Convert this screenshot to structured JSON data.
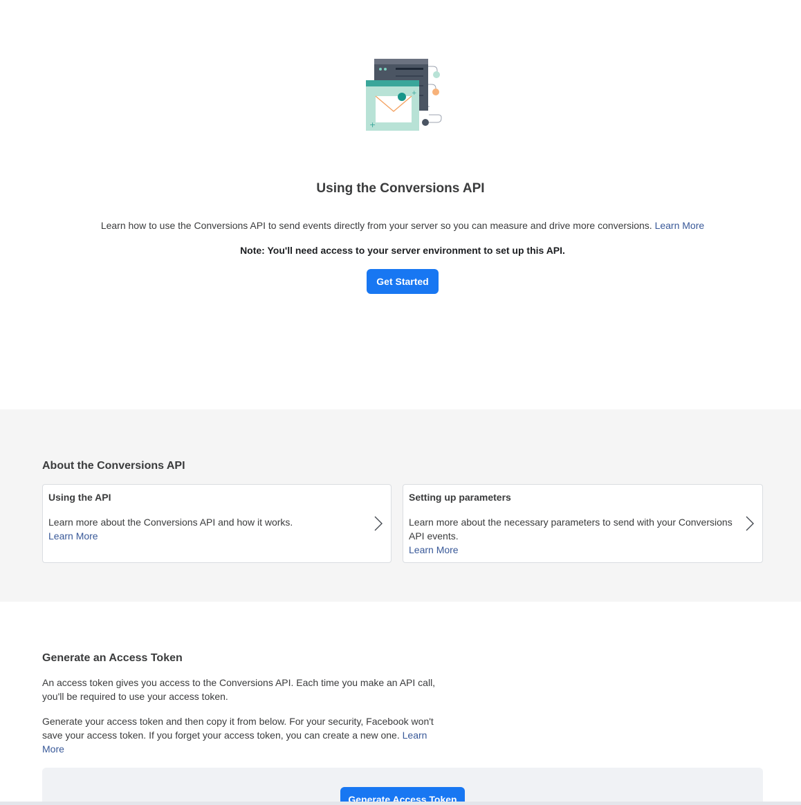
{
  "hero": {
    "title": "Using the Conversions API",
    "description": "Learn how to use the Conversions API to send events directly from your server so you can measure and drive more conversions.",
    "learn_more": "Learn More",
    "note": "Note: You'll need access to your server environment to set up this API.",
    "get_started": "Get Started"
  },
  "about": {
    "title": "About the Conversions API",
    "cards": [
      {
        "title": "Using the API",
        "body": "Learn more about the Conversions API and how it works.",
        "link": "Learn More"
      },
      {
        "title": "Setting up parameters",
        "body": "Learn more about the necessary parameters to send with your Conversions API events.",
        "link": "Learn More"
      }
    ]
  },
  "token": {
    "title": "Generate an Access Token",
    "p1": "An access token gives you access to the Conversions API. Each time you make an API call, you'll be required to use your access token.",
    "p2": "Generate your access token and then copy it from below. For your security, Facebook won't save your access token. If you forget your access token, you can create a new one.",
    "p2_link": "Learn More",
    "generate_button": "Generate Access Token"
  },
  "icons": [
    "server-email-illustration",
    "chevron-right-icon"
  ],
  "colors": {
    "primary": "#1877f2",
    "link": "#385898",
    "section_bg": "#f5f5f5"
  }
}
